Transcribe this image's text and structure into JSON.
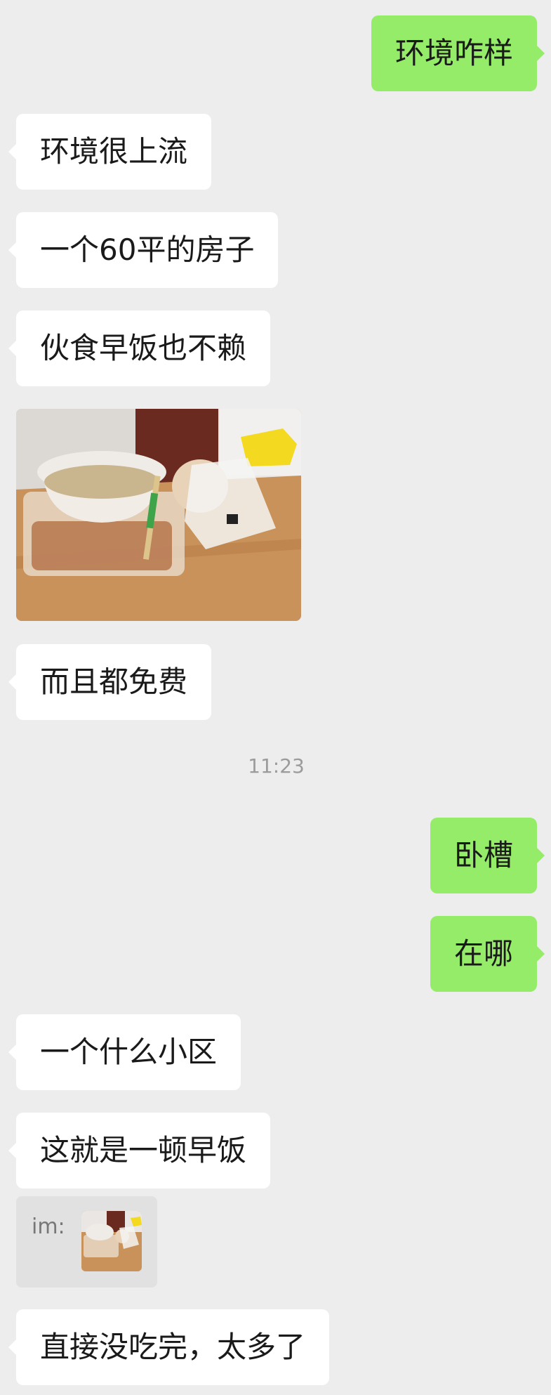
{
  "messages": [
    {
      "side": "out",
      "text": "环境咋样"
    },
    {
      "side": "in",
      "text": "环境很上流"
    },
    {
      "side": "in",
      "text": "一个60平的房子"
    },
    {
      "side": "in",
      "text": "伙食早饭也不赖"
    },
    {
      "side": "in",
      "type": "image",
      "image": "breakfast-photo"
    },
    {
      "side": "in",
      "text": "而且都免费"
    },
    {
      "type": "timestamp",
      "text": "11:23"
    },
    {
      "side": "out",
      "text": "卧槽"
    },
    {
      "side": "out",
      "text": "在哪"
    },
    {
      "side": "in",
      "text": "一个什么小区"
    },
    {
      "side": "in",
      "text": "这就是一顿早饭"
    },
    {
      "side": "in",
      "type": "quote",
      "label": "im:",
      "image": "breakfast-photo-thumbnail"
    },
    {
      "side": "in",
      "text": "直接没吃完，太多了"
    }
  ],
  "colors": {
    "background": "#ededed",
    "incoming_bubble": "#ffffff",
    "outgoing_bubble": "#95ec69"
  }
}
